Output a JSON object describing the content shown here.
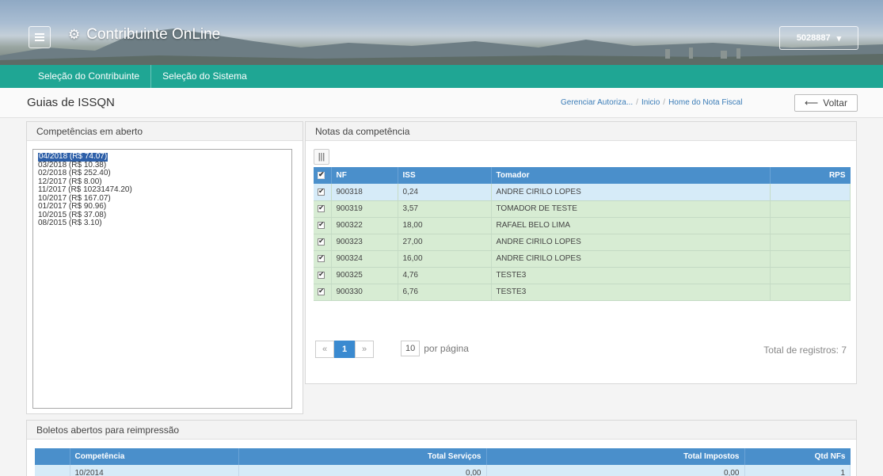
{
  "header": {
    "app_title": "Contribuinte OnLine",
    "user_id": "5028887"
  },
  "nav": {
    "items": [
      "Seleção do Contribuinte",
      "Seleção do Sistema"
    ]
  },
  "titlebar": {
    "title": "Guias de ISSQN",
    "breadcrumb": [
      "Gerenciar Autoriza...",
      "Inicio",
      "Home do Nota Fiscal"
    ],
    "back_label": "Voltar"
  },
  "competencias": {
    "title": "Competências em aberto",
    "items": [
      "04/2018 (R$ 74.07)",
      "03/2018 (R$ 10.38)",
      "02/2018 (R$ 252.40)",
      "12/2017 (R$ 8.00)",
      "11/2017 (R$ 10231474.20)",
      "10/2017 (R$ 167.07)",
      "01/2017 (R$ 90.96)",
      "10/2015 (R$ 37.08)",
      "08/2015 (R$ 3.10)"
    ],
    "selected_index": 0
  },
  "notas": {
    "title": "Notas da competência",
    "columns": [
      "NF",
      "ISS",
      "Tomador",
      "RPS"
    ],
    "rows": [
      {
        "nf": "900318",
        "iss": "0,24",
        "tomador": "ANDRE CIRILO LOPES",
        "rps": ""
      },
      {
        "nf": "900319",
        "iss": "3,57",
        "tomador": "TOMADOR DE TESTE",
        "rps": ""
      },
      {
        "nf": "900322",
        "iss": "18,00",
        "tomador": "RAFAEL BELO LIMA",
        "rps": ""
      },
      {
        "nf": "900323",
        "iss": "27,00",
        "tomador": "ANDRE CIRILO LOPES",
        "rps": ""
      },
      {
        "nf": "900324",
        "iss": "16,00",
        "tomador": "ANDRE CIRILO LOPES",
        "rps": ""
      },
      {
        "nf": "900325",
        "iss": "4,76",
        "tomador": "TESTE3",
        "rps": ""
      },
      {
        "nf": "900330",
        "iss": "6,76",
        "tomador": "TESTE3",
        "rps": ""
      }
    ],
    "pagination": {
      "prev": "«",
      "current": "1",
      "next": "»",
      "per_page_value": "10",
      "per_page_label": "por página",
      "total_label": "Total de registros: 7"
    }
  },
  "boletos": {
    "title": "Boletos abertos para reimpressão",
    "columns": [
      "Competência",
      "Total Serviços",
      "Total Impostos",
      "Qtd NFs"
    ],
    "rows": [
      {
        "competencia": "10/2014",
        "servicos": "0,00",
        "impostos": "0,00",
        "qtd": "1"
      }
    ]
  },
  "colors": {
    "nav": "#1fa694",
    "table_header": "#4a8fcb",
    "row_selected": "#d6ebf8",
    "row_checked": "#d7ecd3"
  }
}
